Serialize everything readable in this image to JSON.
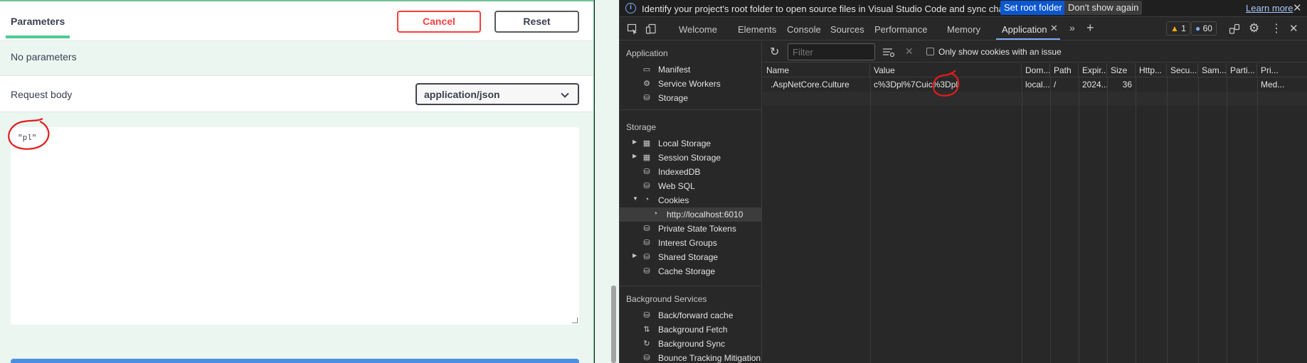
{
  "swagger": {
    "tab_label": "Parameters",
    "cancel_label": "Cancel",
    "reset_label": "Reset",
    "no_params": "No parameters",
    "request_body_label": "Request body",
    "content_type": "application/json",
    "body_value": "\"pl\""
  },
  "devtools": {
    "info_bar": {
      "text": "Identify your project's root folder to open source files in Visual Studio Code and sync changes.",
      "set_root": "Set root folder",
      "dont_show": "Don't show again",
      "learn_more": "Learn more"
    },
    "tabs": [
      "Welcome",
      "Elements",
      "Console",
      "Sources",
      "Performance",
      "Memory",
      "Application"
    ],
    "active_tab": "Application",
    "warnings_count": "1",
    "messages_count": "60",
    "sidebar": {
      "application_title": "Application",
      "application_items": [
        "Manifest",
        "Service Workers",
        "Storage"
      ],
      "storage_title": "Storage",
      "storage_items": [
        "Local Storage",
        "Session Storage",
        "IndexedDB",
        "Web SQL",
        "Cookies"
      ],
      "cookie_origin": "http://localhost:6010",
      "more_items": [
        "Private State Tokens",
        "Interest Groups",
        "Shared Storage",
        "Cache Storage"
      ],
      "bg_title": "Background Services",
      "bg_items": [
        "Back/forward cache",
        "Background Fetch",
        "Background Sync",
        "Bounce Tracking Mitigation"
      ]
    },
    "toolbar": {
      "filter_placeholder": "Filter",
      "only_issue_label": "Only show cookies with an issue"
    },
    "table": {
      "columns": [
        "Name",
        "Value",
        "Dom...",
        "Path",
        "Expir...",
        "Size",
        "Http...",
        "Secu...",
        "Sam...",
        "Parti...",
        "Pri..."
      ],
      "rows": [
        [
          ".AspNetCore.Culture",
          "c%3Dpl%7Cuic%3Dpl",
          "local...",
          "/",
          "2024...",
          "36",
          "",
          "",
          "",
          "",
          "Med..."
        ]
      ]
    }
  }
}
